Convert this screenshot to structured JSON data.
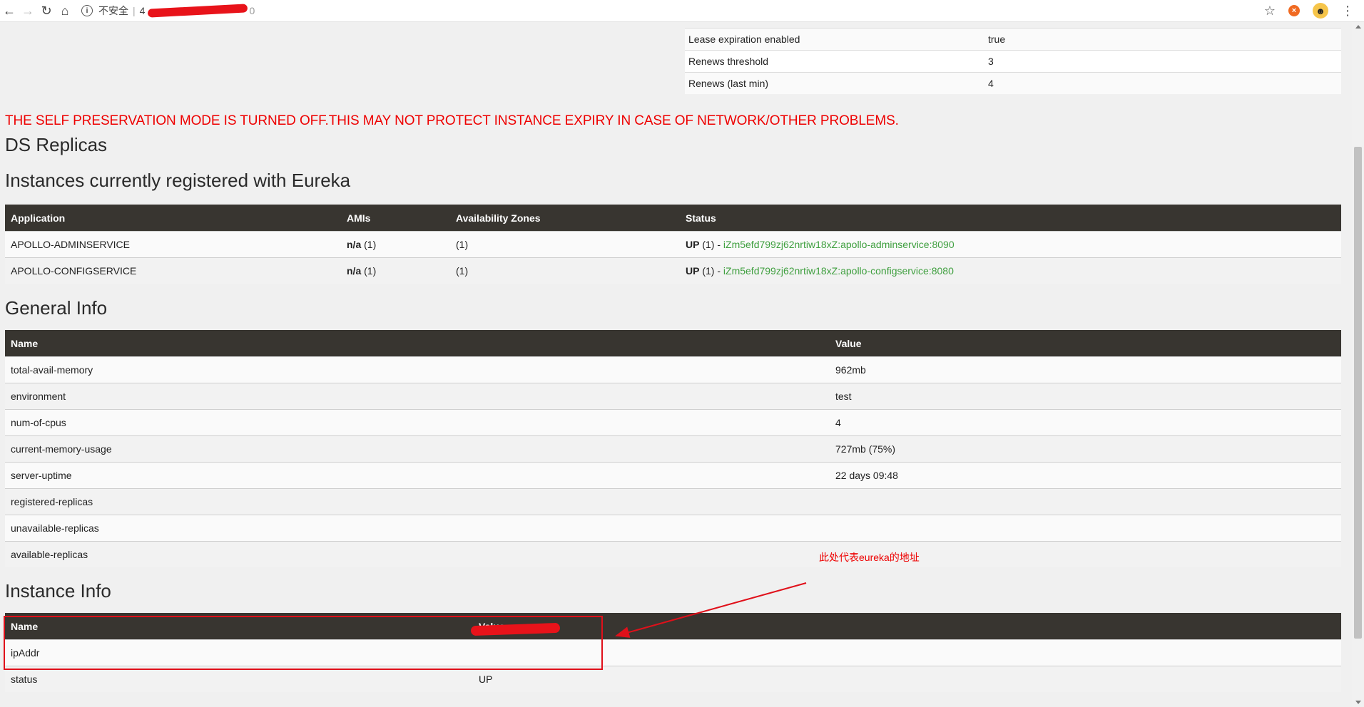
{
  "browser": {
    "security_label": "不安全",
    "url_prefix": "4",
    "url_suffix": "0"
  },
  "lease": {
    "rows": [
      {
        "name": "Lease expiration enabled",
        "value": "true"
      },
      {
        "name": "Renews threshold",
        "value": "3"
      },
      {
        "name": "Renews (last min)",
        "value": "4"
      }
    ]
  },
  "warning": "THE SELF PRESERVATION MODE IS TURNED OFF.THIS MAY NOT PROTECT INSTANCE EXPIRY IN CASE OF NETWORK/OTHER PROBLEMS.",
  "headings": {
    "ds_replicas": "DS Replicas",
    "instances": "Instances currently registered with Eureka",
    "general_info": "General Info",
    "instance_info": "Instance Info"
  },
  "instances": {
    "columns": [
      "Application",
      "AMIs",
      "Availability Zones",
      "Status"
    ],
    "rows": [
      {
        "app": "APOLLO-ADMINSERVICE",
        "ami_bold": "n/a",
        "ami_count": " (1)",
        "zones": "(1)",
        "status_bold": "UP",
        "status_count": " (1) - ",
        "link": "iZm5efd799zj62nrtiw18xZ:apollo-adminservice:8090"
      },
      {
        "app": "APOLLO-CONFIGSERVICE",
        "ami_bold": "n/a",
        "ami_count": " (1)",
        "zones": "(1)",
        "status_bold": "UP",
        "status_count": " (1) - ",
        "link": "iZm5efd799zj62nrtiw18xZ:apollo-configservice:8080"
      }
    ]
  },
  "general": {
    "columns": [
      "Name",
      "Value"
    ],
    "rows": [
      {
        "name": "total-avail-memory",
        "value": "962mb"
      },
      {
        "name": "environment",
        "value": "test"
      },
      {
        "name": "num-of-cpus",
        "value": "4"
      },
      {
        "name": "current-memory-usage",
        "value": "727mb (75%)"
      },
      {
        "name": "server-uptime",
        "value": "22 days 09:48"
      },
      {
        "name": "registered-replicas",
        "value": ""
      },
      {
        "name": "unavailable-replicas",
        "value": ""
      },
      {
        "name": "available-replicas",
        "value": ""
      }
    ]
  },
  "instance_info": {
    "columns": [
      "Name",
      "Value"
    ],
    "rows": [
      {
        "name": "ipAddr",
        "value": ""
      },
      {
        "name": "status",
        "value": "UP"
      }
    ]
  },
  "annotation": "此处代表eureka的地址",
  "colors": {
    "warning": "#ee0000",
    "table_header": "#383530",
    "link": "#3f9f3f",
    "annotation": "#ee0000"
  }
}
